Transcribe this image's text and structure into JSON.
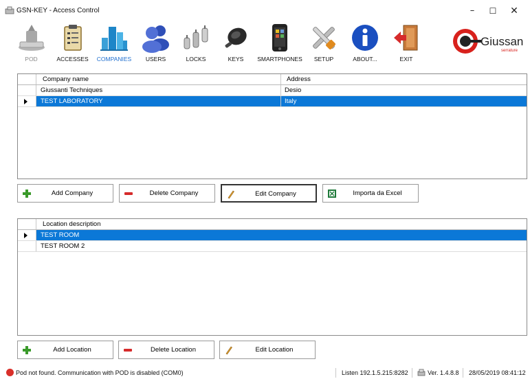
{
  "window": {
    "title": "GSN-KEY - Access Control",
    "minimize": "–",
    "maximize": "☐",
    "close": "✕"
  },
  "toolbar": {
    "items": [
      {
        "label": "POD",
        "icon": "pod-reader-icon",
        "state": "disabled"
      },
      {
        "label": "ACCESSES",
        "icon": "clipboard-icon",
        "state": "normal"
      },
      {
        "label": "COMPANIES",
        "icon": "buildings-icon",
        "state": "active"
      },
      {
        "label": "USERS",
        "icon": "users-icon",
        "state": "normal"
      },
      {
        "label": "LOCKS",
        "icon": "locks-icon",
        "state": "normal"
      },
      {
        "label": "KEYS",
        "icon": "key-fob-icon",
        "state": "normal"
      },
      {
        "label": "SMARTPHONES",
        "icon": "smartphone-icon",
        "state": "normal"
      },
      {
        "label": "SETUP",
        "icon": "tools-icon",
        "state": "normal"
      },
      {
        "label": "ABOUT...",
        "icon": "info-icon",
        "state": "normal"
      },
      {
        "label": "EXIT",
        "icon": "exit-door-icon",
        "state": "normal"
      }
    ]
  },
  "logo": {
    "brand": "Giussani",
    "tagline": "serrature"
  },
  "companies": {
    "columns": [
      "Company name",
      "Address"
    ],
    "rows": [
      {
        "name": "Giussanti Techniques",
        "address": "Desio",
        "selected": false
      },
      {
        "name": "TEST LABORATORY",
        "address": "Italy",
        "selected": true
      }
    ]
  },
  "company_actions": {
    "add": "Add Company",
    "delete": "Delete Company",
    "edit": "Edit Company",
    "import": "Importa da Excel"
  },
  "locations": {
    "columns": [
      "Location description"
    ],
    "rows": [
      {
        "description": "TEST ROOM",
        "selected": true
      },
      {
        "description": "TEST ROOM 2",
        "selected": false
      }
    ]
  },
  "location_actions": {
    "add": "Add Location",
    "delete": "Delete Location",
    "edit": "Edit Location"
  },
  "status": {
    "message": "Pod not found. Communication with POD is disabled (COM0)",
    "listen": "Listen 192.1.5.215:8282",
    "version": "Ver. 1.4.8.8",
    "datetime": "28/05/2019 08:41:12"
  },
  "colors": {
    "selection": "#0b78d7",
    "active_tab": "#1f6fcf",
    "error": "#d9302a"
  }
}
